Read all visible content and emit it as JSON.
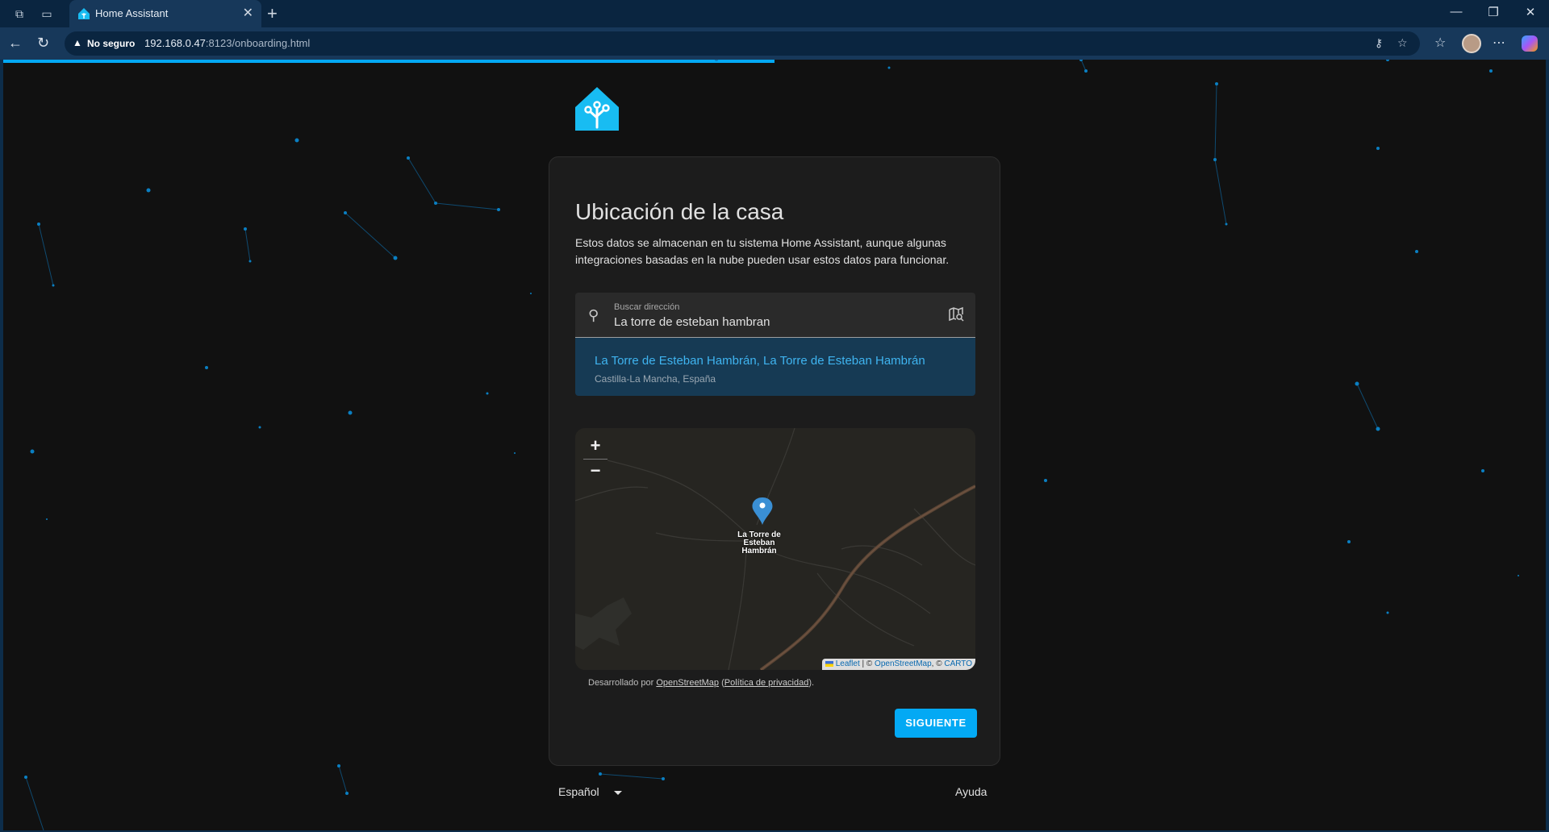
{
  "browser": {
    "tab_title": "Home Assistant",
    "security_label": "No seguro",
    "url_host": "192.168.0.47",
    "url_rest": ":8123/onboarding.html"
  },
  "onboarding": {
    "progress": 0.5,
    "title": "Ubicación de la casa",
    "description": "Estos datos se almacenan en tu sistema Home Assistant, aunque algunas integraciones basadas en la nube pueden usar estos datos para funcionar.",
    "search": {
      "label": "Buscar dirección",
      "value": "La torre de esteban hambran"
    },
    "suggestion": {
      "primary": "La Torre de Esteban Hambrán, La Torre de Esteban Hambrán",
      "secondary": "Castilla-La Mancha, España"
    },
    "map": {
      "zoom_in": "+",
      "zoom_out": "−",
      "marker_label": "La Torre de Esteban Hambrán",
      "attribution_leaflet": "Leaflet",
      "attribution_sep": " | © ",
      "attribution_osm": "OpenStreetMap",
      "attribution_sep2": ", © ",
      "attribution_carto": "CARTO"
    },
    "osm_credit": {
      "prefix": "Desarrollado por ",
      "link": "OpenStreetMap",
      "open_paren": " (",
      "privacy": "Política de privacidad",
      "close": ")."
    },
    "next_button": "SIGUIENTE",
    "language": "Español",
    "help": "Ayuda"
  },
  "colors": {
    "accent": "#03a9f4",
    "card_bg": "#1c1c1c",
    "page_bg": "#111111"
  }
}
